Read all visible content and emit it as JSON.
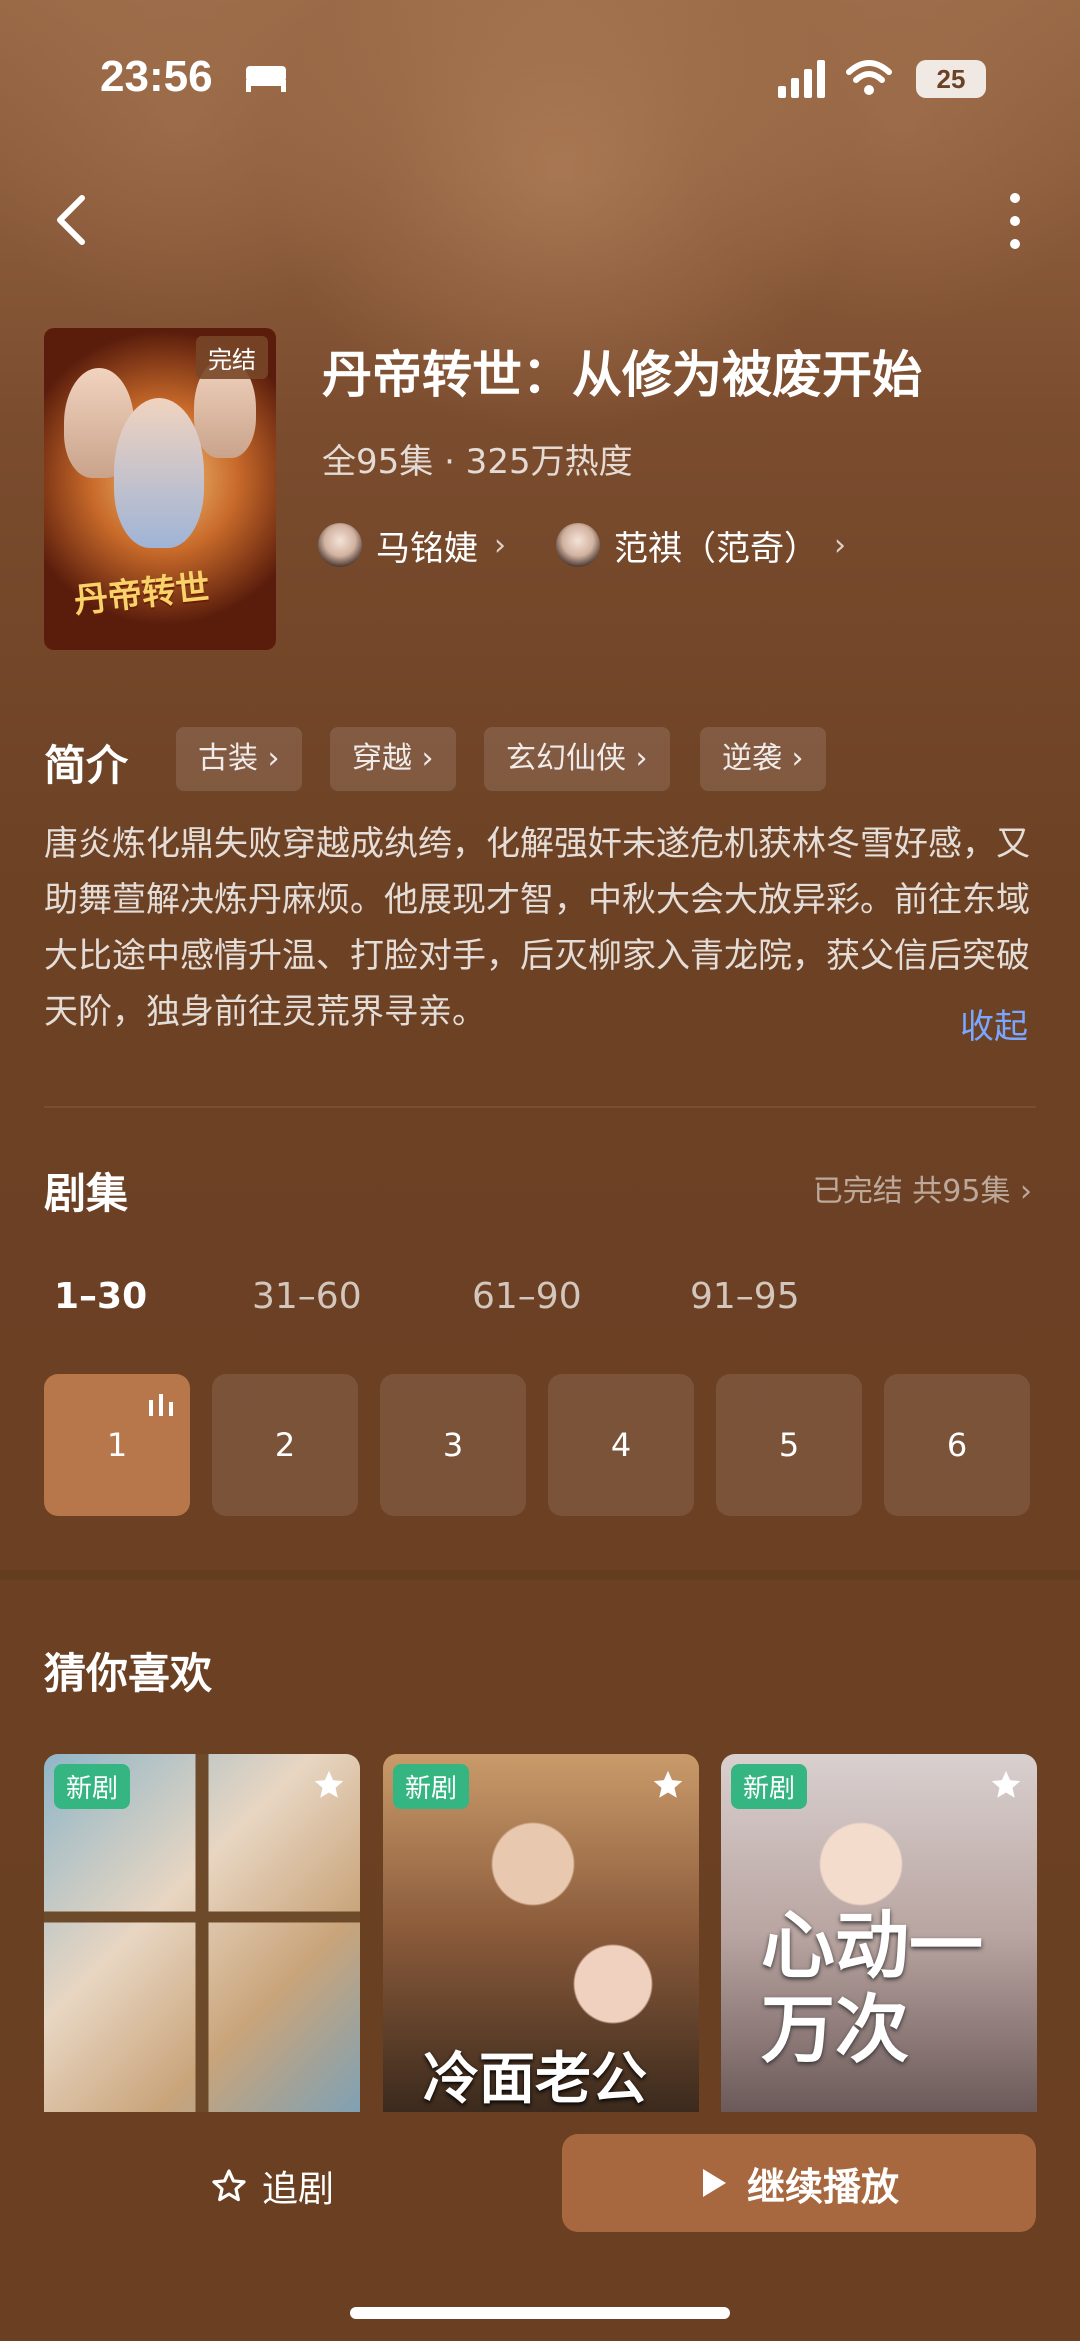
{
  "status_bar": {
    "time": "23:56",
    "battery": "25"
  },
  "drama": {
    "title": "丹帝转世：从修为被废开始",
    "meta": "全95集 · 325万热度",
    "badge": "完结",
    "poster_text": "丹帝转世",
    "actors": [
      {
        "name": "马铭婕"
      },
      {
        "name": "范祺（范奇）"
      }
    ]
  },
  "intro": {
    "label": "简介",
    "tags": [
      "古装 ›",
      "穿越 ›",
      "玄幻仙侠 ›",
      "逆袭 ›"
    ],
    "description": "唐炎炼化鼎失败穿越成纨绔，化解强奸未遂危机获林冬雪好感，又助舞萱解决炼丹麻烦。他展现才智，中秋大会大放异彩。前往东域大比途中感情升温、打脸对手，后灭柳家入青龙院，获父信后突破天阶，独身前往灵荒界寻亲。",
    "collapse": "收起"
  },
  "episodes": {
    "label": "剧集",
    "status": "已完结 共95集 ›",
    "ranges": [
      "1–30",
      "31–60",
      "61–90",
      "91–95"
    ],
    "items": [
      "1",
      "2",
      "3",
      "4",
      "5",
      "6"
    ]
  },
  "recommend": {
    "label": "猜你喜欢",
    "cards": [
      {
        "badge": "新剧",
        "art": ""
      },
      {
        "badge": "新剧",
        "art": "冷面老公"
      },
      {
        "badge": "新剧",
        "art": "心动一万次"
      }
    ]
  },
  "actions": {
    "follow": "追剧",
    "play": "继续播放"
  },
  "colors": {
    "accent": "#a8683f",
    "new_badge": "#35b582",
    "link": "#7aa7ff"
  }
}
